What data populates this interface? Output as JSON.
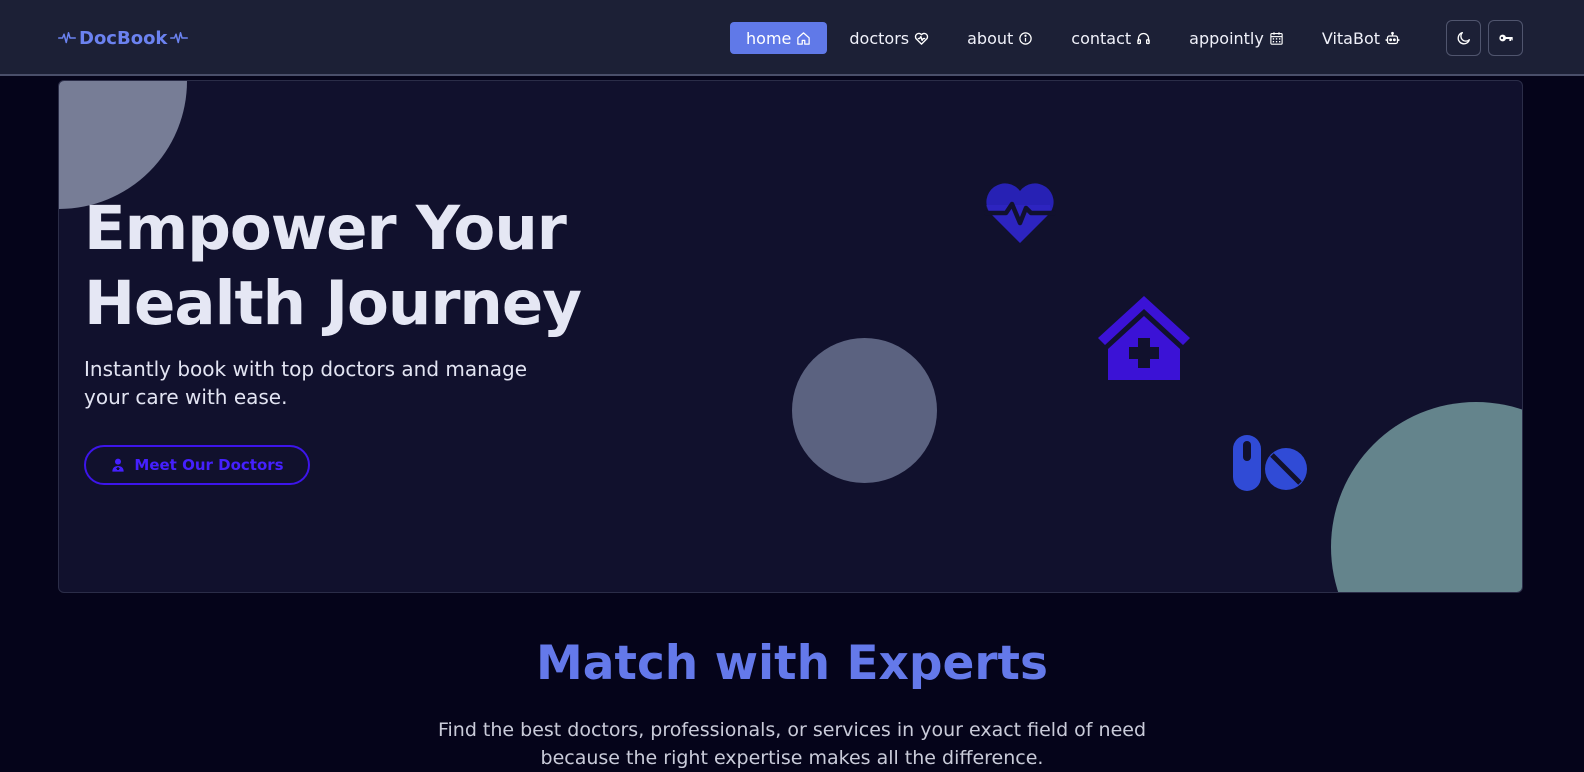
{
  "nav": {
    "brand": "DocBook",
    "links": [
      {
        "label": "home",
        "active": true,
        "icon": "home-icon"
      },
      {
        "label": "doctors",
        "active": false,
        "icon": "heart-icon"
      },
      {
        "label": "about",
        "active": false,
        "icon": "info-icon"
      },
      {
        "label": "contact",
        "active": false,
        "icon": "headphones-icon"
      },
      {
        "label": "appointly",
        "active": false,
        "icon": "calendar-icon"
      },
      {
        "label": "VitaBot",
        "active": false,
        "icon": "robot-icon"
      }
    ],
    "theme_toggle_icon": "moon-icon",
    "login_icon": "key-icon"
  },
  "hero": {
    "title": "Empower Your Health Journey",
    "subtitle": "Instantly book with top doctors and manage your care with ease.",
    "cta_label": "Meet Our Doctors",
    "cta_icon": "doctor-icon",
    "decor_icons": [
      "heartbeat-icon",
      "hospital-icon",
      "pills-icon"
    ]
  },
  "section": {
    "title": "Match with Experts",
    "description": "Find the best doctors, professionals, or services in your exact field of need because the right expertise makes all the difference."
  },
  "colors": {
    "accent": "#6079e8",
    "page_bg": "#05041a",
    "nav_bg": "#1c2036",
    "hero_bg": "#11112d",
    "cta": "#3d15ea"
  }
}
